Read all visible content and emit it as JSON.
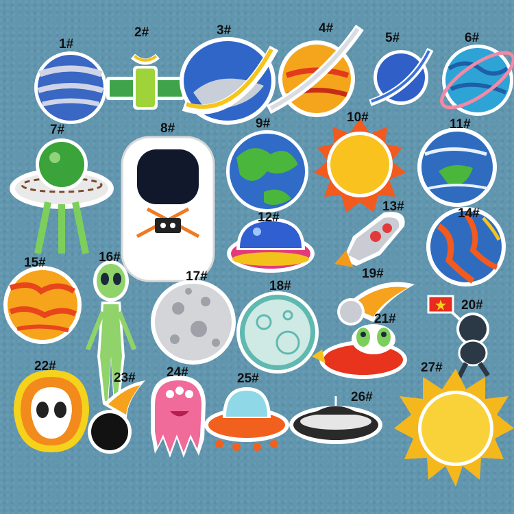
{
  "labels": {
    "p1": "1#",
    "p2": "2#",
    "p3": "3#",
    "p4": "4#",
    "p5": "5#",
    "p6": "6#",
    "p7": "7#",
    "p8": "8#",
    "p9": "9#",
    "p10": "10#",
    "p11": "11#",
    "p12": "12#",
    "p13": "13#",
    "p14": "14#",
    "p15": "15#",
    "p16": "16#",
    "p17": "17#",
    "p18": "18#",
    "p19": "19#",
    "p20": "20#",
    "p21": "21#",
    "p22": "22#",
    "p23": "23#",
    "p24": "24#",
    "p25": "25#",
    "p26": "26#",
    "p27": "27#"
  },
  "colors": {
    "background": "#6196af",
    "patch_border": "#ffffff",
    "label_text": "#111111"
  }
}
